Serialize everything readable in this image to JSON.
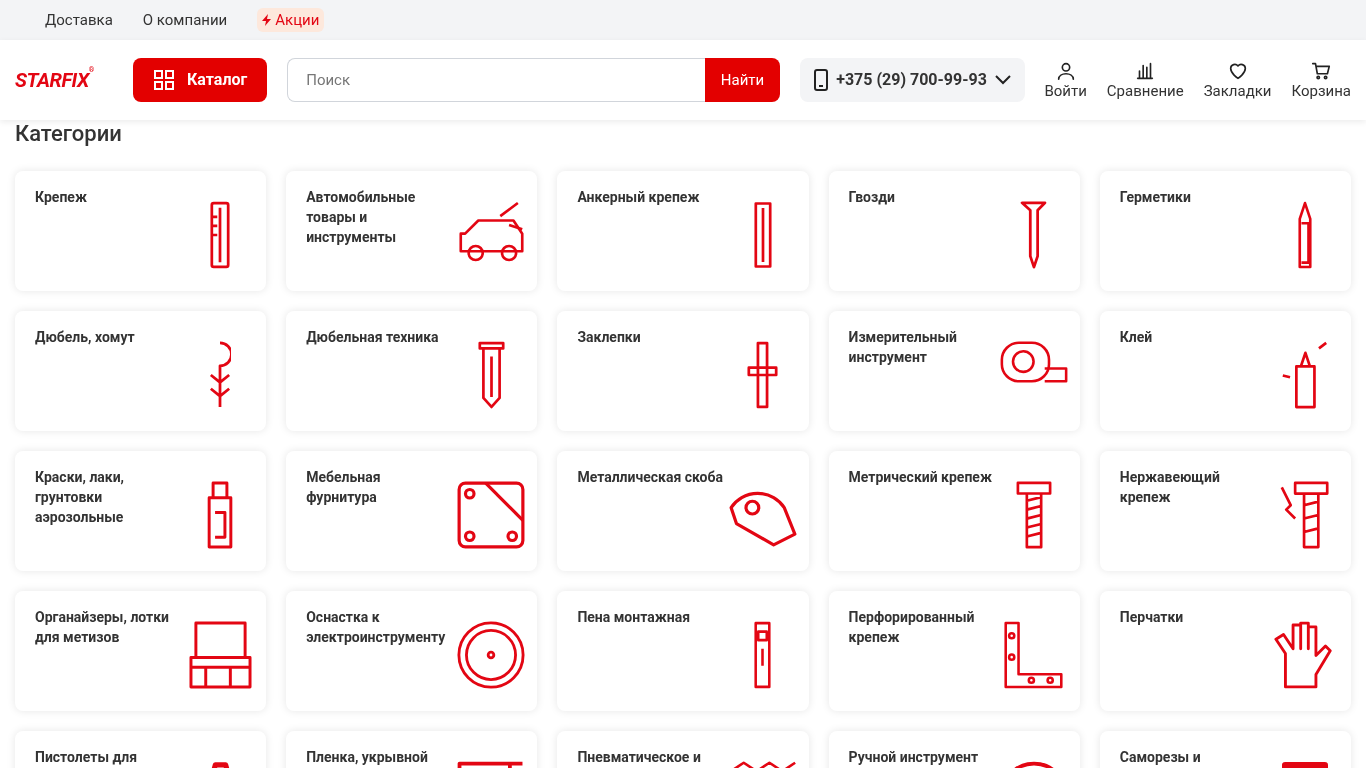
{
  "top_nav": {
    "links": [
      {
        "label": "Доставка"
      },
      {
        "label": "О компании"
      }
    ],
    "promo": {
      "label": "Акции"
    }
  },
  "header": {
    "logo": {
      "text": "STARFIX",
      "mark": "®"
    },
    "catalog_button": "Каталог",
    "search": {
      "placeholder": "Поиск",
      "button": "Найти"
    },
    "phone": "+375 (29) 700-99-93",
    "actions": [
      {
        "kind": "user",
        "label": "Войти"
      },
      {
        "kind": "compare",
        "label": "Сравнение"
      },
      {
        "kind": "heart",
        "label": "Закладки"
      },
      {
        "kind": "cart",
        "label": "Корзина"
      }
    ]
  },
  "categories": {
    "title": "Категории",
    "items": [
      {
        "label": "Крепеж"
      },
      {
        "label": "Автомобильные товары и инструменты"
      },
      {
        "label": "Анкерный крепеж"
      },
      {
        "label": "Гвозди"
      },
      {
        "label": "Герметики"
      },
      {
        "label": "Дюбель, хомут"
      },
      {
        "label": "Дюбельная техника"
      },
      {
        "label": "Заклепки"
      },
      {
        "label": "Измерительный инструмент"
      },
      {
        "label": "Клей"
      },
      {
        "label": "Краски, лаки, грунтовки аэрозольные"
      },
      {
        "label": "Мебельная фурнитура"
      },
      {
        "label": "Металлическая скоба"
      },
      {
        "label": "Метрический крепеж"
      },
      {
        "label": "Нержавеющий крепеж"
      },
      {
        "label": "Органайзеры, лотки для метизов"
      },
      {
        "label": "Оснастка к электроинструменту"
      },
      {
        "label": "Пена монтажная"
      },
      {
        "label": "Перфорированный крепеж"
      },
      {
        "label": "Перчатки"
      },
      {
        "label": "Пистолеты для"
      },
      {
        "label": "Пленка, укрывной"
      },
      {
        "label": "Пневматическое и"
      },
      {
        "label": "Ручной инструмент"
      },
      {
        "label": "Саморезы и"
      }
    ]
  }
}
